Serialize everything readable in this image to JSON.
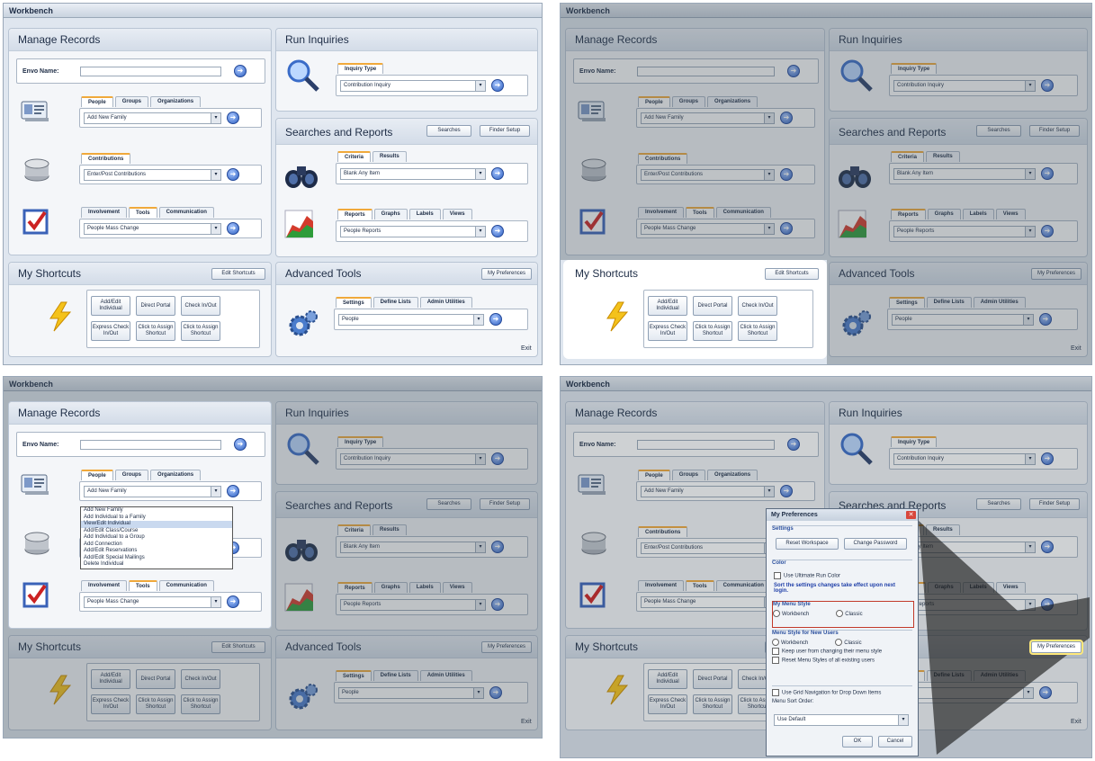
{
  "app": {
    "title": "Workbench"
  },
  "sections": {
    "manage_records": "Manage Records",
    "run_inquiries": "Run Inquiries",
    "searches_reports": "Searches and Reports",
    "my_shortcuts": "My Shortcuts",
    "advanced_tools": "Advanced Tools"
  },
  "manage": {
    "env_label": "Envo Name:",
    "people_tabs": [
      "People",
      "Groups",
      "Organizations"
    ],
    "people_select": "Add New Family",
    "contrib_tabs": [
      "Contributions"
    ],
    "contrib_select": "Enter/Post Contributions",
    "tools_tabs": [
      "Involvement",
      "Tools",
      "Communication"
    ],
    "tools_select": "People Mass Change"
  },
  "inquiry": {
    "tabs": [
      "Inquiry Type"
    ],
    "select": "Contribution Inquiry"
  },
  "searches": {
    "buttons": [
      "Searches",
      "Finder Setup"
    ],
    "criteria_tabs": [
      "Criteria",
      "Results"
    ],
    "criteria_select": "Blank Any Item",
    "report_tabs": [
      "Reports",
      "Graphs",
      "Labels",
      "Views"
    ],
    "report_select": "People Reports"
  },
  "shortcuts": {
    "edit_button": "Edit Shortcuts",
    "items": [
      "Add/Edit Individual",
      "Direct Portal",
      "Check In/Out",
      "Express Check In/Out",
      "Click to Assign Shortcut",
      "Click to Assign Shortcut"
    ]
  },
  "advanced": {
    "pref_button": "My Preferences",
    "tabs": [
      "Settings",
      "Define Lists",
      "Admin Utilities"
    ],
    "select": "People"
  },
  "footer": {
    "exit": "Exit"
  },
  "dropdown": {
    "items": [
      "Add New Family",
      "Add Individual to a Family",
      "View/Edit Individual",
      "Add/Edit Class/Course",
      "Add Individual to a Group",
      "Add Connection",
      "Add/Edit Reservations",
      "Add/Edit Special Mailings",
      "Delete Individual"
    ],
    "highlight_index": 2
  },
  "dialog": {
    "title": "My Preferences",
    "settings_header": "Settings",
    "btn_reset": "Reset Workspace",
    "btn_password": "Change Password",
    "color_header": "Color",
    "use_color_label": "Use Ultimate Run Color",
    "note": "Sort the settings changes take effect upon next login.",
    "menu_style_header": "My Menu Style",
    "menu_style_opts": [
      "Workbench",
      "Classic"
    ],
    "new_users_header": "Menu Style for New Users",
    "new_users_opts": [
      "Workbench",
      "Classic"
    ],
    "check1": "Keep user from changing their menu style",
    "check2": "Reset Menu Styles of all existing users",
    "check3": "Use Grid Navigation for Drop Down Items",
    "sort_label": "Menu Sort Order:",
    "sort_value": "Use Default",
    "ok": "OK",
    "cancel": "Cancel",
    "callout": "My Preferences"
  }
}
